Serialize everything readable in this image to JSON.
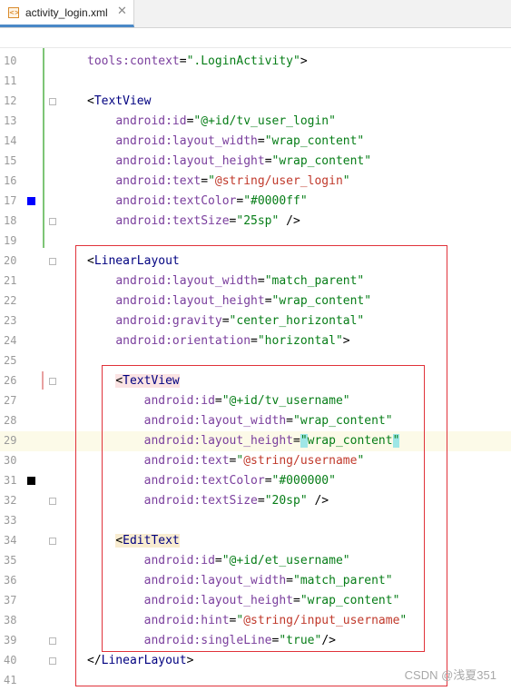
{
  "tab": {
    "filename": "activity_login.xml",
    "close": "✕",
    "icon": "xml-file-icon"
  },
  "lines": [
    {
      "n": "10",
      "parts": [
        {
          "c": "a",
          "t": "tools:context"
        },
        {
          "c": "p",
          "t": "="
        },
        {
          "c": "v",
          "t": "\".LoginActivity\""
        },
        {
          "c": "p",
          "t": ">"
        }
      ]
    },
    {
      "n": "11",
      "parts": []
    },
    {
      "n": "12",
      "parts": [
        {
          "c": "p",
          "t": "<"
        },
        {
          "c": "t",
          "t": "TextView"
        }
      ]
    },
    {
      "n": "13",
      "parts": [
        {
          "c": "p",
          "t": "    "
        },
        {
          "c": "a",
          "t": "android:id"
        },
        {
          "c": "p",
          "t": "="
        },
        {
          "c": "v",
          "t": "\"@+id/tv_user_login\""
        }
      ]
    },
    {
      "n": "14",
      "parts": [
        {
          "c": "p",
          "t": "    "
        },
        {
          "c": "a",
          "t": "android:layout_width"
        },
        {
          "c": "p",
          "t": "="
        },
        {
          "c": "v",
          "t": "\"wrap_content\""
        }
      ]
    },
    {
      "n": "15",
      "parts": [
        {
          "c": "p",
          "t": "    "
        },
        {
          "c": "a",
          "t": "android:layout_height"
        },
        {
          "c": "p",
          "t": "="
        },
        {
          "c": "v",
          "t": "\"wrap_content\""
        }
      ]
    },
    {
      "n": "16",
      "parts": [
        {
          "c": "p",
          "t": "    "
        },
        {
          "c": "a",
          "t": "android:text"
        },
        {
          "c": "p",
          "t": "="
        },
        {
          "c": "v",
          "t": "\""
        },
        {
          "c": "r",
          "t": "@string/user_login"
        },
        {
          "c": "v",
          "t": "\""
        }
      ]
    },
    {
      "n": "17",
      "parts": [
        {
          "c": "p",
          "t": "    "
        },
        {
          "c": "a",
          "t": "android:textColor"
        },
        {
          "c": "p",
          "t": "="
        },
        {
          "c": "v",
          "t": "\"#0000ff\""
        }
      ]
    },
    {
      "n": "18",
      "parts": [
        {
          "c": "p",
          "t": "    "
        },
        {
          "c": "a",
          "t": "android:textSize"
        },
        {
          "c": "p",
          "t": "="
        },
        {
          "c": "v",
          "t": "\"25sp\""
        },
        {
          "c": "p",
          "t": " />"
        }
      ]
    },
    {
      "n": "19",
      "parts": []
    },
    {
      "n": "20",
      "parts": [
        {
          "c": "p",
          "t": "<"
        },
        {
          "c": "t",
          "t": "LinearLayout"
        }
      ]
    },
    {
      "n": "21",
      "parts": [
        {
          "c": "p",
          "t": "    "
        },
        {
          "c": "a",
          "t": "android:layout_width"
        },
        {
          "c": "p",
          "t": "="
        },
        {
          "c": "v",
          "t": "\"match_parent\""
        }
      ]
    },
    {
      "n": "22",
      "parts": [
        {
          "c": "p",
          "t": "    "
        },
        {
          "c": "a",
          "t": "android:layout_height"
        },
        {
          "c": "p",
          "t": "="
        },
        {
          "c": "v",
          "t": "\"wrap_content\""
        }
      ]
    },
    {
      "n": "23",
      "parts": [
        {
          "c": "p",
          "t": "    "
        },
        {
          "c": "a",
          "t": "android:gravity"
        },
        {
          "c": "p",
          "t": "="
        },
        {
          "c": "v",
          "t": "\"center_horizontal\""
        }
      ]
    },
    {
      "n": "24",
      "parts": [
        {
          "c": "p",
          "t": "    "
        },
        {
          "c": "a",
          "t": "android:orientation"
        },
        {
          "c": "p",
          "t": "="
        },
        {
          "c": "v",
          "t": "\"horizontal\""
        },
        {
          "c": "p",
          "t": ">"
        }
      ]
    },
    {
      "n": "25",
      "parts": []
    },
    {
      "n": "26",
      "parts": [
        {
          "c": "p",
          "t": "    "
        },
        {
          "c": "p mark-tag",
          "t": "<"
        },
        {
          "c": "t mark-tag",
          "t": "TextView"
        }
      ]
    },
    {
      "n": "27",
      "parts": [
        {
          "c": "p",
          "t": "        "
        },
        {
          "c": "a",
          "t": "android:id"
        },
        {
          "c": "p",
          "t": "="
        },
        {
          "c": "v",
          "t": "\"@+id/tv_username\""
        }
      ]
    },
    {
      "n": "28",
      "parts": [
        {
          "c": "p",
          "t": "        "
        },
        {
          "c": "a",
          "t": "android:layout_width"
        },
        {
          "c": "p",
          "t": "="
        },
        {
          "c": "v",
          "t": "\"wrap_content\""
        }
      ]
    },
    {
      "n": "29",
      "parts": [
        {
          "c": "p",
          "t": "        "
        },
        {
          "c": "a",
          "t": "android:layout_height"
        },
        {
          "c": "p",
          "t": "="
        },
        {
          "c": "v q-hl",
          "t": "\""
        },
        {
          "c": "v",
          "t": "wrap_content"
        },
        {
          "c": "v q-hl",
          "t": "\""
        }
      ]
    },
    {
      "n": "30",
      "parts": [
        {
          "c": "p",
          "t": "        "
        },
        {
          "c": "a",
          "t": "android:text"
        },
        {
          "c": "p",
          "t": "="
        },
        {
          "c": "v",
          "t": "\""
        },
        {
          "c": "r",
          "t": "@string/username"
        },
        {
          "c": "v",
          "t": "\""
        }
      ]
    },
    {
      "n": "31",
      "parts": [
        {
          "c": "p",
          "t": "        "
        },
        {
          "c": "a",
          "t": "android:textColor"
        },
        {
          "c": "p",
          "t": "="
        },
        {
          "c": "v",
          "t": "\"#000000\""
        }
      ]
    },
    {
      "n": "32",
      "parts": [
        {
          "c": "p",
          "t": "        "
        },
        {
          "c": "a",
          "t": "android:textSize"
        },
        {
          "c": "p",
          "t": "="
        },
        {
          "c": "v",
          "t": "\"20sp\""
        },
        {
          "c": "p",
          "t": " />"
        }
      ]
    },
    {
      "n": "33",
      "parts": []
    },
    {
      "n": "34",
      "parts": [
        {
          "c": "p",
          "t": "    "
        },
        {
          "c": "p mark-tag2",
          "t": "<"
        },
        {
          "c": "t mark-tag2",
          "t": "EditText"
        }
      ]
    },
    {
      "n": "35",
      "parts": [
        {
          "c": "p",
          "t": "        "
        },
        {
          "c": "a",
          "t": "android:id"
        },
        {
          "c": "p",
          "t": "="
        },
        {
          "c": "v",
          "t": "\"@+id/et_username\""
        }
      ]
    },
    {
      "n": "36",
      "parts": [
        {
          "c": "p",
          "t": "        "
        },
        {
          "c": "a",
          "t": "android:layout_width"
        },
        {
          "c": "p",
          "t": "="
        },
        {
          "c": "v",
          "t": "\"match_parent\""
        }
      ]
    },
    {
      "n": "37",
      "parts": [
        {
          "c": "p",
          "t": "        "
        },
        {
          "c": "a",
          "t": "android:layout_height"
        },
        {
          "c": "p",
          "t": "="
        },
        {
          "c": "v",
          "t": "\"wrap_content\""
        }
      ]
    },
    {
      "n": "38",
      "parts": [
        {
          "c": "p",
          "t": "        "
        },
        {
          "c": "a",
          "t": "android:hint"
        },
        {
          "c": "p",
          "t": "="
        },
        {
          "c": "v",
          "t": "\""
        },
        {
          "c": "r",
          "t": "@string/input_username"
        },
        {
          "c": "v",
          "t": "\""
        }
      ]
    },
    {
      "n": "39",
      "parts": [
        {
          "c": "p",
          "t": "        "
        },
        {
          "c": "a",
          "t": "android:singleLine"
        },
        {
          "c": "p",
          "t": "="
        },
        {
          "c": "v",
          "t": "\"true\""
        },
        {
          "c": "p",
          "t": "/>"
        }
      ]
    },
    {
      "n": "40",
      "parts": [
        {
          "c": "p",
          "t": "</"
        },
        {
          "c": "t",
          "t": "LinearLayout"
        },
        {
          "c": "p",
          "t": ">"
        }
      ]
    },
    {
      "n": "41",
      "parts": []
    }
  ],
  "swatches": {
    "17": "#0000ff",
    "31": "#000000"
  },
  "folds": [
    "12",
    "18",
    "20",
    "26",
    "32",
    "34",
    "39",
    "40"
  ],
  "highlight_line": "29",
  "watermark": "CSDN @浅夏351"
}
